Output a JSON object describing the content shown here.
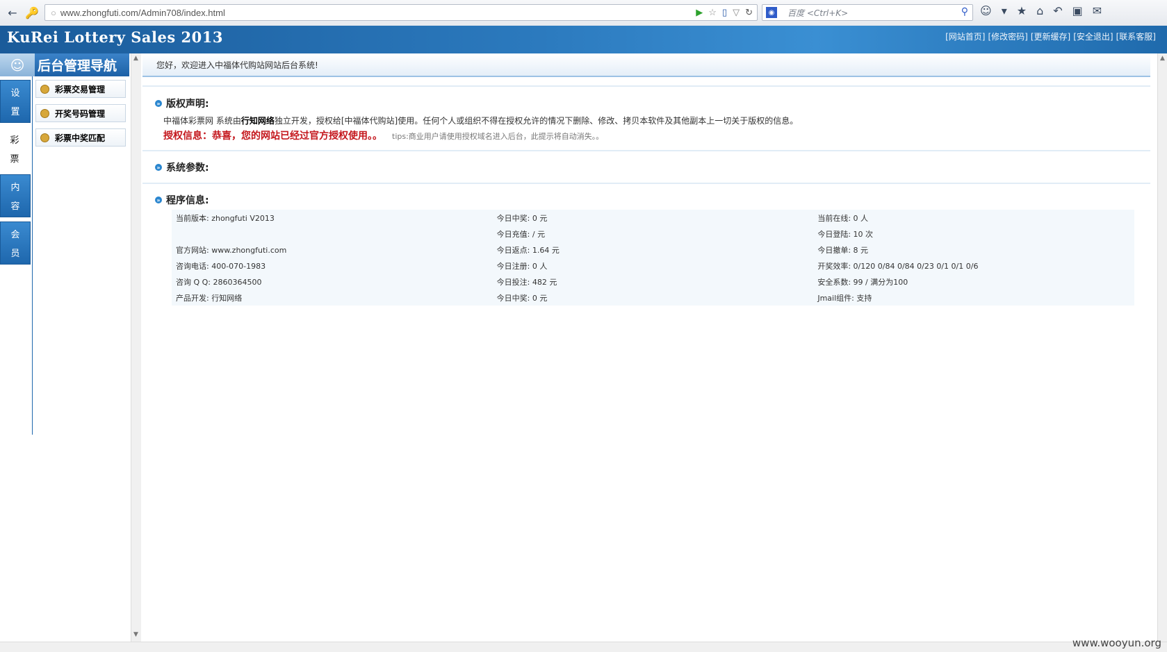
{
  "browser": {
    "url": "www.zhongfuti.com/Admin708/index.html",
    "search_placeholder": "百度 <Ctrl+K>"
  },
  "header": {
    "title": "KuRei Lottery Sales 2013",
    "links": [
      "[网站首页]",
      "[修改密码]",
      "[更新缓存]",
      "[安全退出]",
      "[联系客服]"
    ]
  },
  "sidebar": {
    "title": "后台管理导航",
    "tabs": [
      {
        "c1": "设",
        "c2": "置"
      },
      {
        "c1": "彩",
        "c2": "票"
      },
      {
        "c1": "内",
        "c2": "容"
      },
      {
        "c1": "会",
        "c2": "员"
      }
    ],
    "items": [
      "彩票交易管理",
      "开奖号码管理",
      "彩票中奖匹配"
    ]
  },
  "main": {
    "welcome": "您好，欢迎进入中福体代购站网站后台系统!",
    "copyright_title": "版权声明:",
    "copyright_pre": "中福体彩票网 系统由",
    "copyright_company": "行知网络",
    "copyright_post": "独立开发，授权给[中福体代购站]使用。任何个人或组织不得在授权允许的情况下删除、修改、拷贝本软件及其他副本上一切关于版权的信息。",
    "auth_text": "授权信息：恭喜，您的网站已经过官方授权使用。。",
    "auth_tips": "tips:商业用户请使用授权域名进入后台，此提示将自动消失。。",
    "sys_params_title": "系统参数:",
    "program_info_title": "程序信息:",
    "info_rows": [
      [
        "当前版本: zhongfuti V2013",
        "今日中奖: 0 元",
        "当前在线: 0 人"
      ],
      [
        "",
        "今日充值: / 元",
        "今日登陆: 10 次"
      ],
      [
        "官方网站: www.zhongfuti.com",
        "今日返点: 1.64 元",
        "今日撤单: 8 元"
      ],
      [
        "咨询电话: 400-070-1983",
        "今日注册: 0 人",
        "开奖效率: 0/120 0/84 0/84 0/23 0/1 0/1 0/6"
      ],
      [
        "咨询 Q Q: 2860364500",
        "今日投注: 482 元",
        "安全系数: 99 / 满分为100"
      ],
      [
        "产品开发: 行知网络",
        "今日中奖: 0 元",
        "Jmail组件: 支持"
      ]
    ]
  },
  "watermark": "www.wooyun.org"
}
